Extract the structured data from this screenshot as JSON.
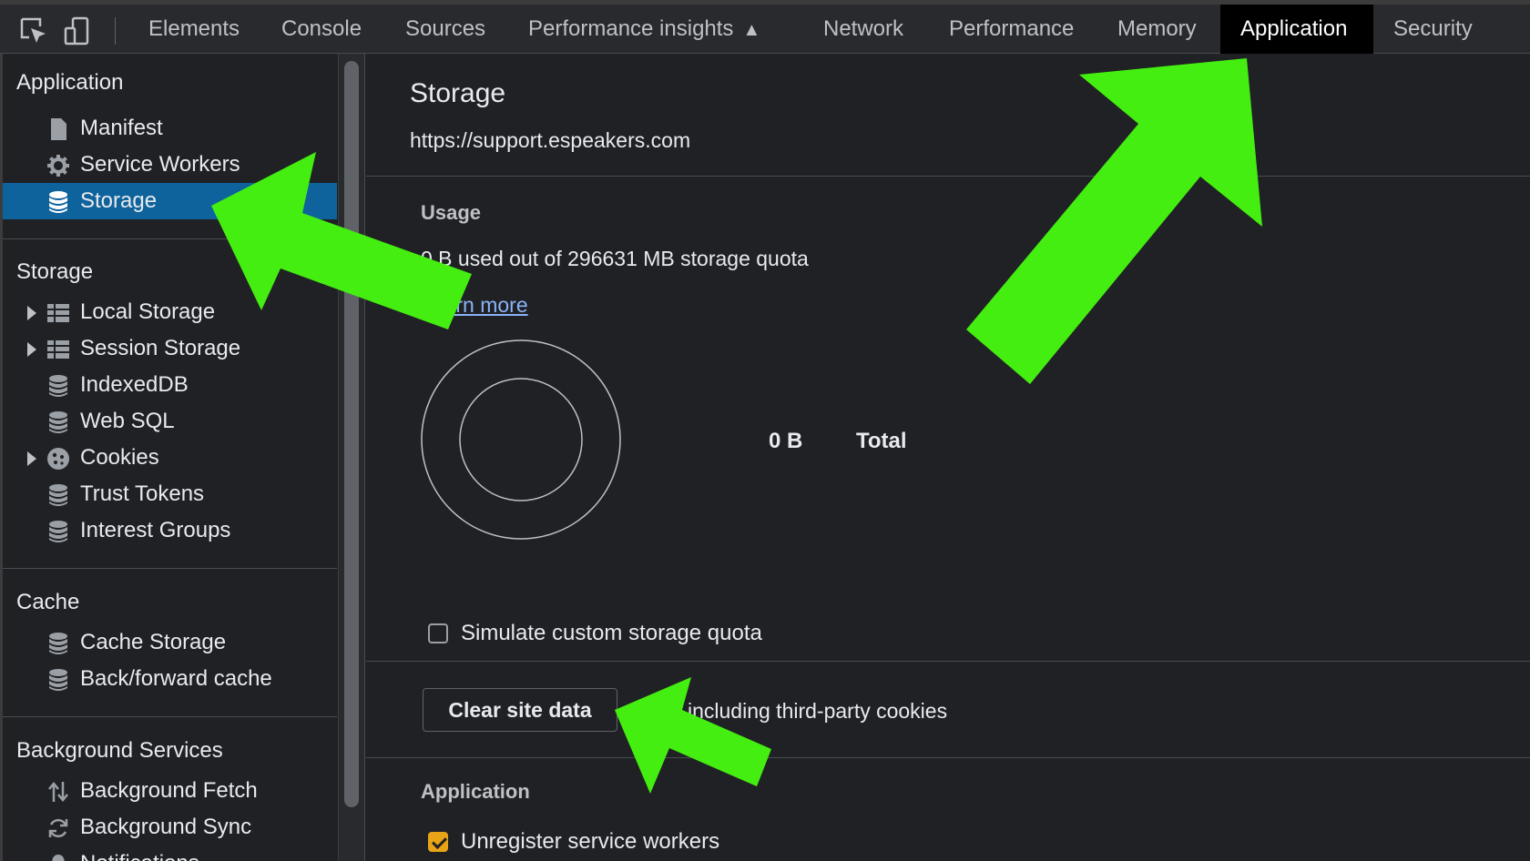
{
  "toolbar": {
    "icons": [
      "inspect-element-icon",
      "device-toolbar-icon"
    ],
    "tabs": [
      {
        "label": "Elements"
      },
      {
        "label": "Console"
      },
      {
        "label": "Sources"
      },
      {
        "label": "Performance insights"
      },
      {
        "label": "Network"
      },
      {
        "label": "Performance"
      },
      {
        "label": "Memory"
      },
      {
        "label": "Application",
        "active": true
      },
      {
        "label": "Security"
      }
    ]
  },
  "sidebar": {
    "application": {
      "title": "Application",
      "items": [
        {
          "label": "Manifest",
          "icon": "file-icon"
        },
        {
          "label": "Service Workers",
          "icon": "gear-icon"
        },
        {
          "label": "Storage",
          "icon": "database-icon",
          "selected": true
        }
      ]
    },
    "storage": {
      "title": "Storage",
      "items": [
        {
          "label": "Local Storage",
          "icon": "table-icon",
          "expandable": true
        },
        {
          "label": "Session Storage",
          "icon": "table-icon",
          "expandable": true
        },
        {
          "label": "IndexedDB",
          "icon": "database-icon"
        },
        {
          "label": "Web SQL",
          "icon": "database-icon"
        },
        {
          "label": "Cookies",
          "icon": "cookie-icon",
          "expandable": true
        },
        {
          "label": "Trust Tokens",
          "icon": "database-icon"
        },
        {
          "label": "Interest Groups",
          "icon": "database-icon"
        }
      ]
    },
    "cache": {
      "title": "Cache",
      "items": [
        {
          "label": "Cache Storage",
          "icon": "database-icon"
        },
        {
          "label": "Back/forward cache",
          "icon": "database-icon"
        }
      ]
    },
    "background": {
      "title": "Background Services",
      "items": [
        {
          "label": "Background Fetch",
          "icon": "up-down-arrows-icon"
        },
        {
          "label": "Background Sync",
          "icon": "sync-icon"
        },
        {
          "label": "Notifications",
          "icon": "bell-icon"
        }
      ]
    }
  },
  "main": {
    "title": "Storage",
    "origin": "https://support.espeakers.com",
    "usage": {
      "title": "Usage",
      "text": "0 B used out of 296631 MB storage quota",
      "learn_more": "Learn more",
      "total_value": "0 B",
      "total_label": "Total"
    },
    "simulate_quota": {
      "label": "Simulate custom storage quota",
      "checked": false
    },
    "clear_button": "Clear site data",
    "third_party_text": "including third-party cookies",
    "application_section": {
      "title": "Application",
      "unregister": {
        "label": "Unregister service workers",
        "checked": true
      }
    }
  },
  "colors": {
    "background": "#202124",
    "selected": "#0e639c",
    "link": "#8ab4f8",
    "checkbox_checked": "#e8a317",
    "annotation_arrow": "#44ee11"
  }
}
